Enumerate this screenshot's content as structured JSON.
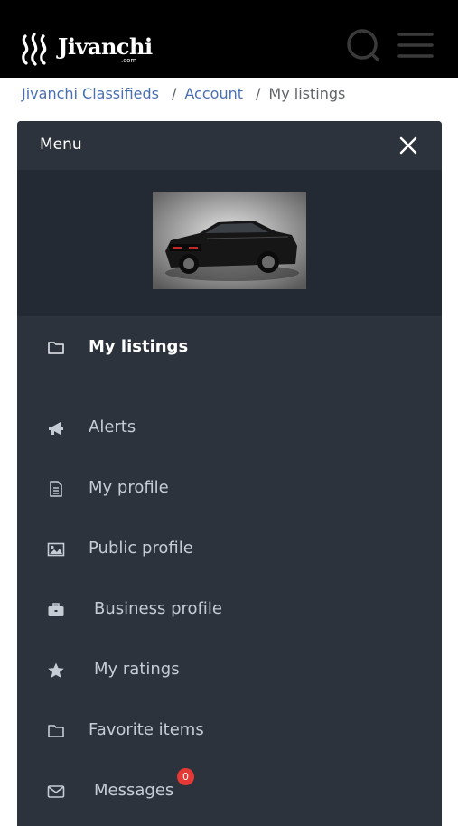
{
  "header": {
    "brand": "Jivanchi",
    "brand_sub": ".com",
    "search_icon": "search-icon",
    "menu_icon": "hamburger-icon"
  },
  "breadcrumb": {
    "items": [
      "Jivanchi Classifieds",
      "Account",
      "My listings"
    ],
    "separator": "/"
  },
  "menu": {
    "title": "Menu",
    "close_icon": "close-icon",
    "avatar_alt": "profile car image",
    "items": [
      {
        "label": "My listings",
        "icon": "folder-icon",
        "active": true
      },
      {
        "label": "Alerts",
        "icon": "megaphone-icon"
      },
      {
        "label": "My profile",
        "icon": "document-icon"
      },
      {
        "label": "Public profile",
        "icon": "image-icon"
      },
      {
        "label": "Business profile",
        "icon": "briefcase-icon"
      },
      {
        "label": "My ratings",
        "icon": "star-icon"
      },
      {
        "label": "Favorite items",
        "icon": "folder-icon"
      },
      {
        "label": "Messages",
        "icon": "envelope-icon",
        "badge": "0"
      }
    ]
  },
  "colors": {
    "topbar": "#000000",
    "panel": "#2c333d",
    "avatar_band": "#242a33",
    "link": "#4a6fb3",
    "badge": "#e53935"
  }
}
